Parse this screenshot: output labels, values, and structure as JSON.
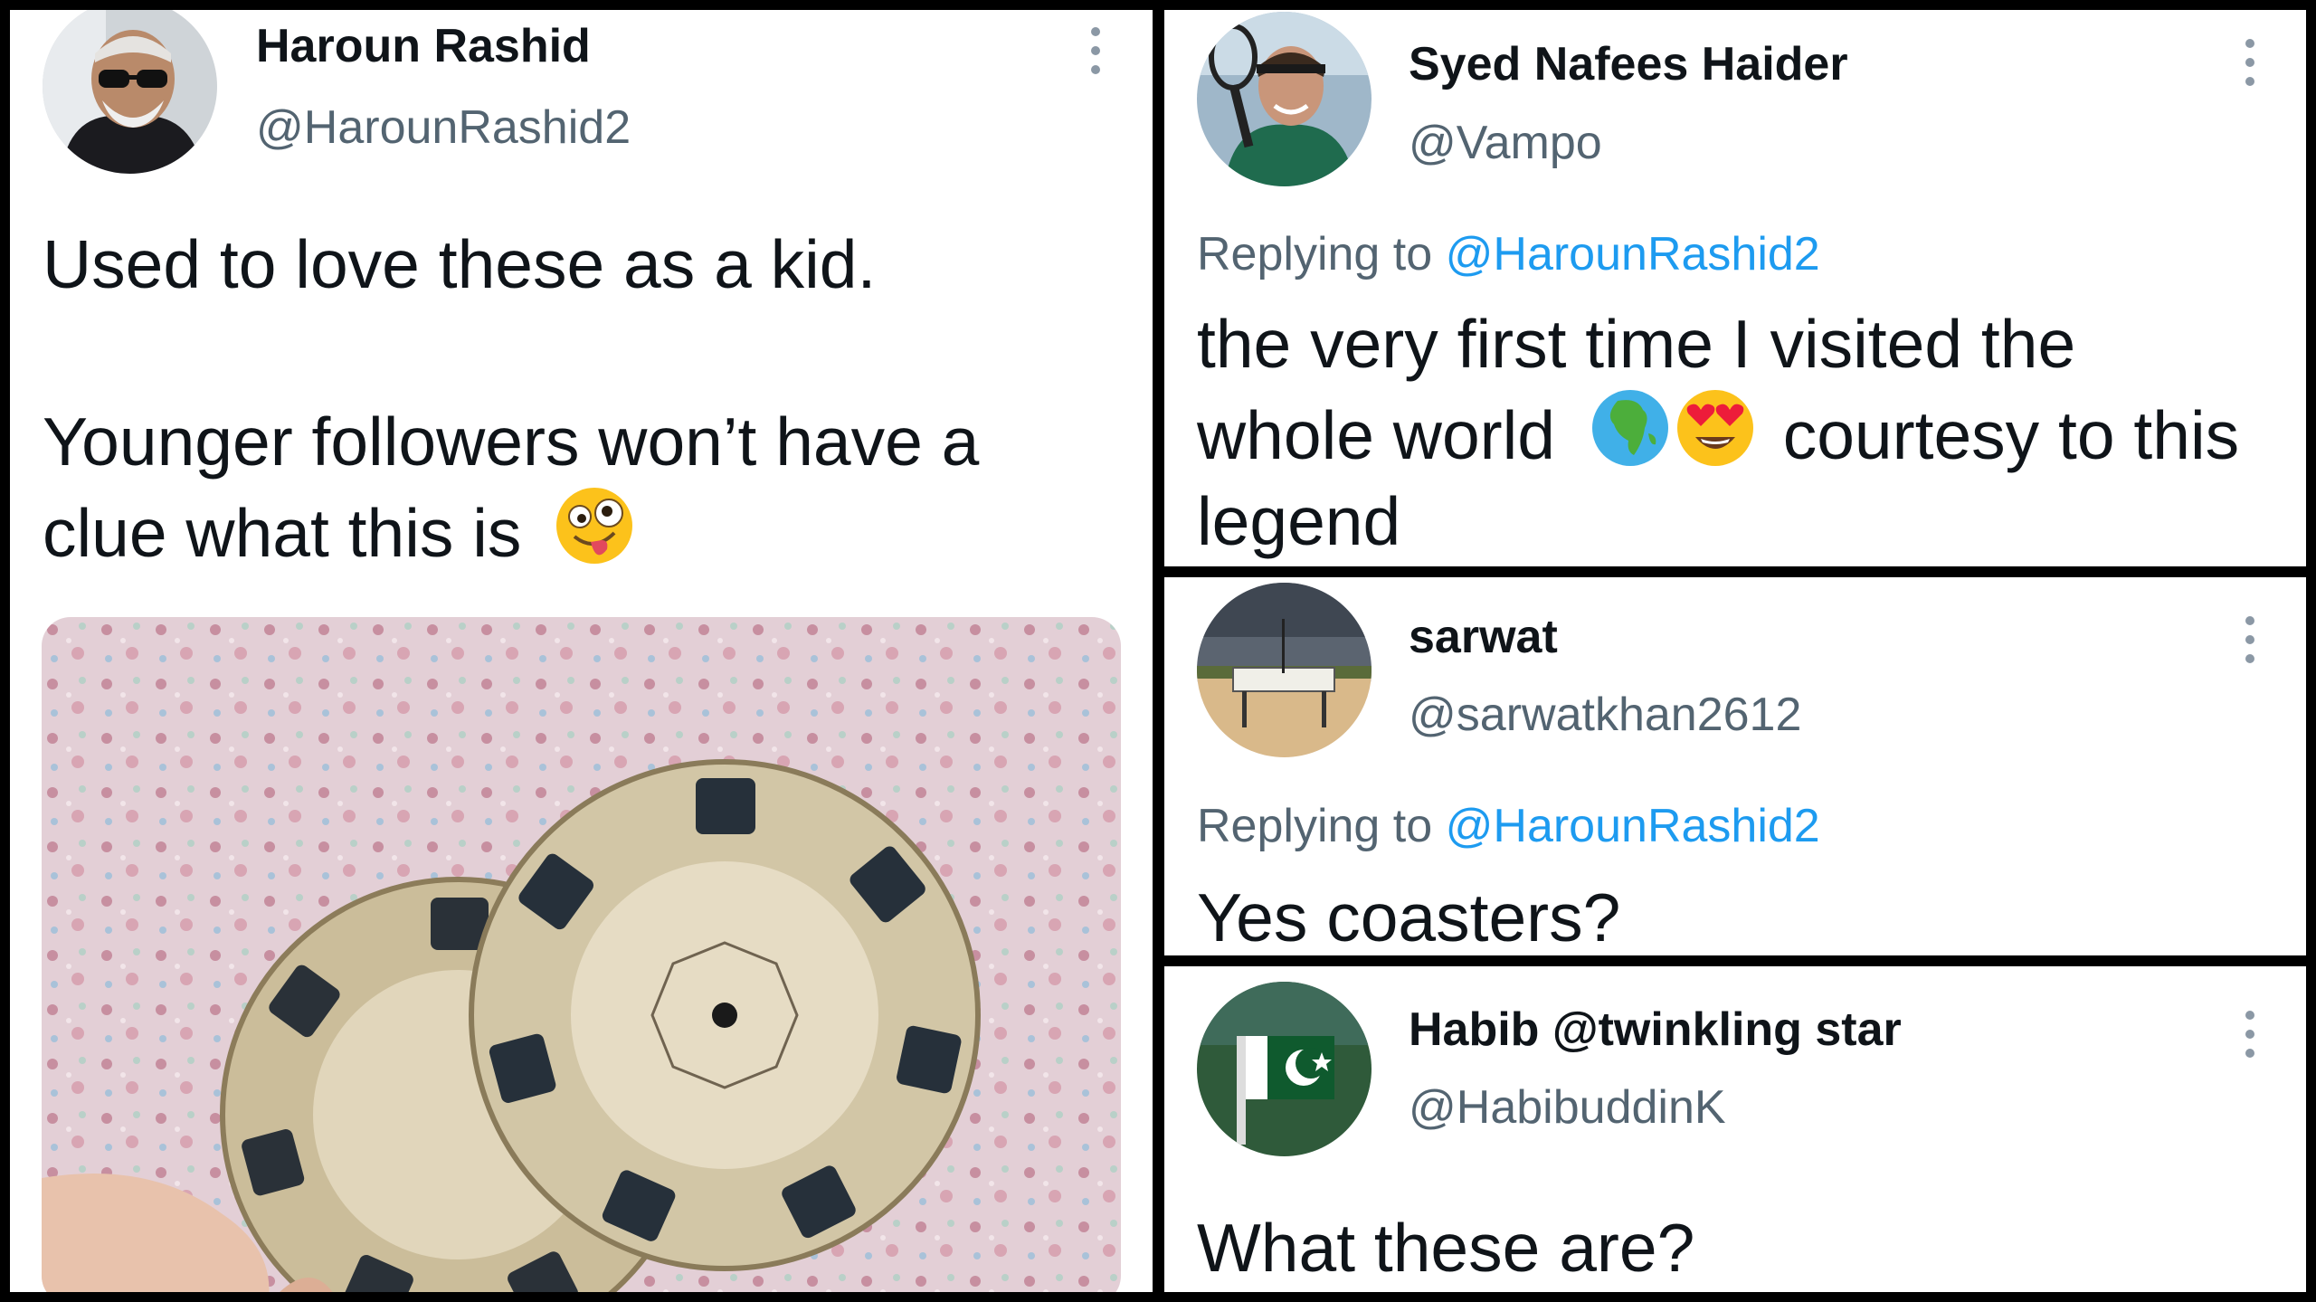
{
  "tweet": {
    "name": "Haroun Rashid",
    "handle": "@HarounRashid2",
    "line1": "Used to love these as a kid.",
    "line2": "Younger followers won’t have a",
    "line3": "clue what this is",
    "emoji": "zany-face"
  },
  "replies": [
    {
      "name": "Syed Nafees Haider",
      "handle": "@Vampo",
      "replying_label": "Replying to",
      "replying_to": "@HarounRashid2",
      "line1": "the very first time I visited the",
      "line2a": "whole world",
      "line2b": "courtesy to this",
      "line3": "legend",
      "emojis": [
        "globe-africa",
        "heart-eyes-face"
      ]
    },
    {
      "name": "sarwat",
      "handle": "@sarwatkhan2612",
      "replying_label": "Replying to",
      "replying_to": "@HarounRashid2",
      "text": "Yes coasters?"
    },
    {
      "name": "Habib @twinkling star",
      "handle": "@HabibuddinK",
      "text": "What these are?"
    }
  ],
  "colors": {
    "name_text": "#0f1419",
    "handle_text": "#536471",
    "mention_link": "#1d9bf0",
    "divider": "#000000",
    "panel_bg": "#ffffff"
  }
}
